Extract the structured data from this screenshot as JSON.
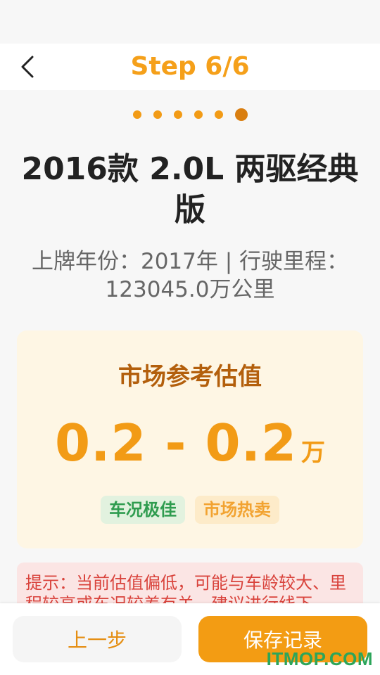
{
  "header": {
    "title": "Step 6/6"
  },
  "progress": {
    "total_steps": 6,
    "current_step": 6
  },
  "car": {
    "name": "2016款 2.0L 两驱经典版",
    "info": "上牌年份：2017年 | 行驶里程：123045.0万公里"
  },
  "valuation": {
    "title": "市场参考估值",
    "range": "0.2 - 0.2",
    "unit": "万",
    "tags": [
      "车况极佳",
      "市场热卖"
    ]
  },
  "tip": "提示：当前估值偏低，可能与车龄较大、里程较高或车况较差有关，建议进行线下",
  "buttons": {
    "prev": "上一步",
    "save": "保存记录"
  },
  "watermark": "ITMOP.COM",
  "colors": {
    "accent": "#f29b16",
    "title": "#f5a01a",
    "tip": "#d9433c"
  },
  "icons": {
    "back": "chevron-left-icon"
  }
}
